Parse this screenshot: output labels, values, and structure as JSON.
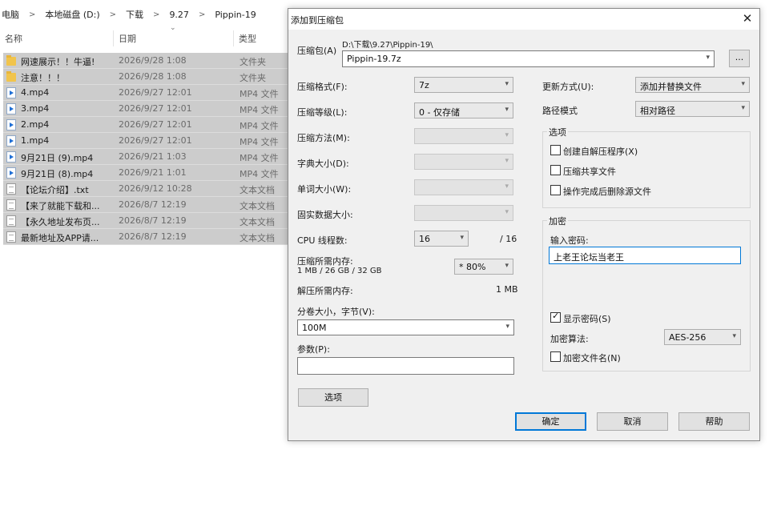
{
  "explorer": {
    "breadcrumb": [
      "电脑",
      "本地磁盘 (D:)",
      "下载",
      "9.27",
      "Pippin-19"
    ],
    "columns": {
      "name": "名称",
      "date": "日期",
      "type": "类型"
    },
    "files": [
      {
        "name": "网速展示！！牛逼!",
        "date": "2026/9/28 1:08",
        "type": "文件夹",
        "icon": "folder-icon"
      },
      {
        "name": "注意！！！",
        "date": "2026/9/28 1:08",
        "type": "文件夹",
        "icon": "folder-icon"
      },
      {
        "name": "4.mp4",
        "date": "2026/9/27 12:01",
        "type": "MP4 文件",
        "icon": "video-file-icon"
      },
      {
        "name": "3.mp4",
        "date": "2026/9/27 12:01",
        "type": "MP4 文件",
        "icon": "video-file-icon"
      },
      {
        "name": "2.mp4",
        "date": "2026/9/27 12:01",
        "type": "MP4 文件",
        "icon": "video-file-icon"
      },
      {
        "name": "1.mp4",
        "date": "2026/9/27 12:01",
        "type": "MP4 文件",
        "icon": "video-file-icon"
      },
      {
        "name": "9月21日 (9).mp4",
        "date": "2026/9/21 1:03",
        "type": "MP4 文件",
        "icon": "video-file-icon"
      },
      {
        "name": "9月21日 (8).mp4",
        "date": "2026/9/21 1:01",
        "type": "MP4 文件",
        "icon": "video-file-icon"
      },
      {
        "name": "【论坛介绍】.txt",
        "date": "2026/9/12 10:28",
        "type": "文本文档",
        "icon": "text-file-icon"
      },
      {
        "name": "【来了就能下载和...",
        "date": "2026/8/7 12:19",
        "type": "文本文档",
        "icon": "text-file-icon"
      },
      {
        "name": "【永久地址发布页...",
        "date": "2026/8/7 12:19",
        "type": "文本文档",
        "icon": "text-file-icon"
      },
      {
        "name": "最新地址及APP请...",
        "date": "2026/8/7 12:19",
        "type": "文本文档",
        "icon": "text-file-icon"
      }
    ]
  },
  "dialog": {
    "title": "添加到压缩包",
    "close": "✕",
    "archive": {
      "label": "压缩包(A)",
      "path": "D:\\下载\\9.27\\Pippin-19\\",
      "name": "Pippin-19.7z",
      "browse": "..."
    },
    "format": {
      "label": "压缩格式(F):",
      "value": "7z"
    },
    "level": {
      "label": "压缩等级(L):",
      "value": "0 - 仅存储"
    },
    "method": {
      "label": "压缩方法(M):"
    },
    "dict": {
      "label": "字典大小(D):"
    },
    "word": {
      "label": "单词大小(W):"
    },
    "solid": {
      "label": "固实数据大小:"
    },
    "cpu": {
      "label": "CPU 线程数:",
      "value": "16",
      "total": "/ 16"
    },
    "mem": {
      "label": "压缩所需内存:",
      "detail": "1 MB / 26 GB / 32 GB",
      "value": "* 80%"
    },
    "decomp": {
      "label": "解压所需内存:",
      "value": "1 MB"
    },
    "split": {
      "label": "分卷大小，字节(V):",
      "value": "100M"
    },
    "params": {
      "label": "参数(P):",
      "value": ""
    },
    "options_btn": "选项",
    "update": {
      "label": "更新方式(U):",
      "value": "添加并替换文件"
    },
    "pathmode": {
      "label": "路径模式",
      "value": "相对路径"
    },
    "options_group": {
      "legend": "选项",
      "sfx": "创建自解压程序(X)",
      "shared": "压缩共享文件",
      "delete": "操作完成后删除源文件"
    },
    "encryption": {
      "legend": "加密",
      "pwd_label": "输入密码:",
      "pwd_value": "上老王论坛当老王",
      "show_pwd": "显示密码(S)",
      "method_label": "加密算法:",
      "method_value": "AES-256",
      "encrypt_names": "加密文件名(N)"
    },
    "ok": "确定",
    "cancel": "取消",
    "help": "帮助"
  }
}
